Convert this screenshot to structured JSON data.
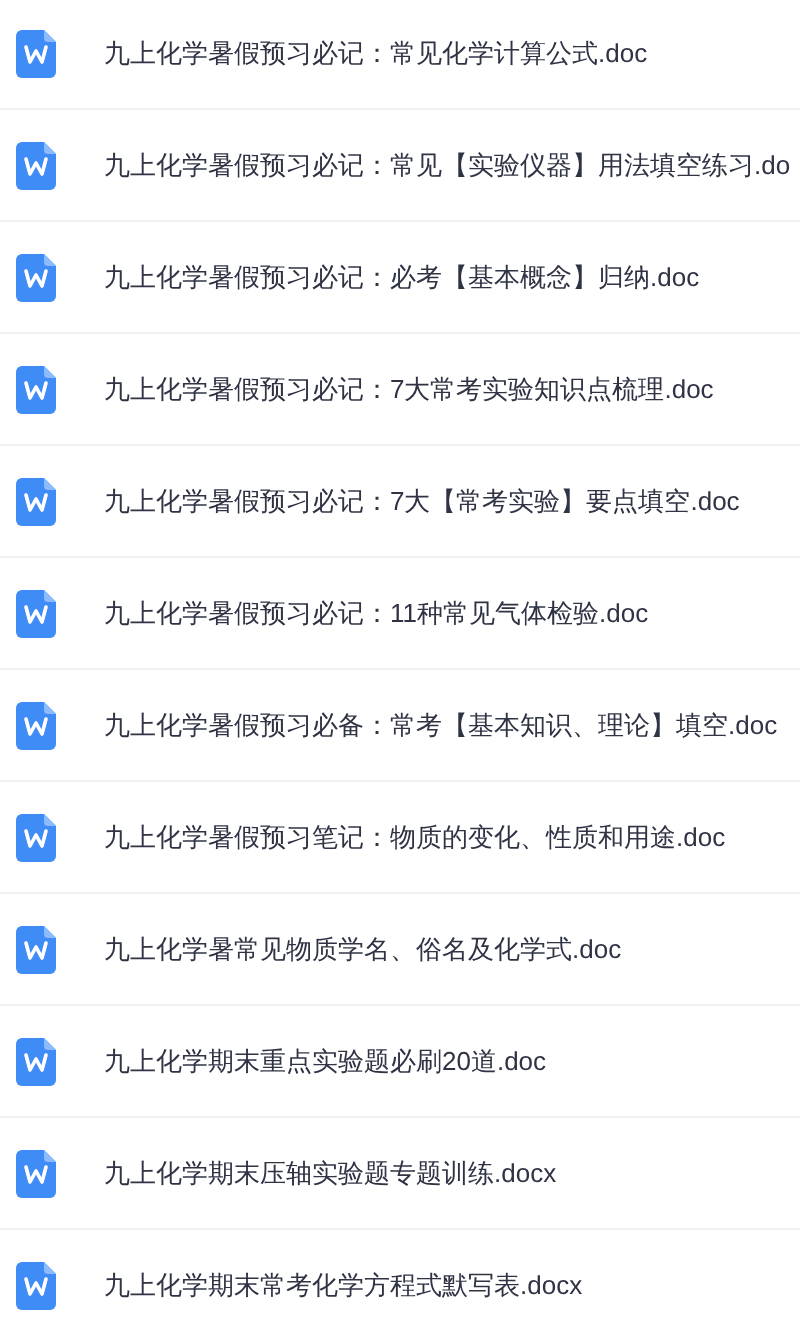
{
  "files": [
    {
      "name": "九上化学暑假预习必记：常见化学计算公式.doc"
    },
    {
      "name": "九上化学暑假预习必记：常见【实验仪器】用法填空练习.do"
    },
    {
      "name": "九上化学暑假预习必记：必考【基本概念】归纳.doc"
    },
    {
      "name": "九上化学暑假预习必记：7大常考实验知识点梳理.doc"
    },
    {
      "name": "九上化学暑假预习必记：7大【常考实验】要点填空.doc"
    },
    {
      "name": "九上化学暑假预习必记：11种常见气体检验.doc"
    },
    {
      "name": "九上化学暑假预习必备：常考【基本知识、理论】填空.doc"
    },
    {
      "name": "九上化学暑假预习笔记：物质的变化、性质和用途.doc"
    },
    {
      "name": "九上化学暑常见物质学名、俗名及化学式.doc"
    },
    {
      "name": "九上化学期末重点实验题必刷20道.doc"
    },
    {
      "name": "九上化学期末压轴实验题专题训练.docx"
    },
    {
      "name": "九上化学期末常考化学方程式默写表.docx"
    }
  ]
}
